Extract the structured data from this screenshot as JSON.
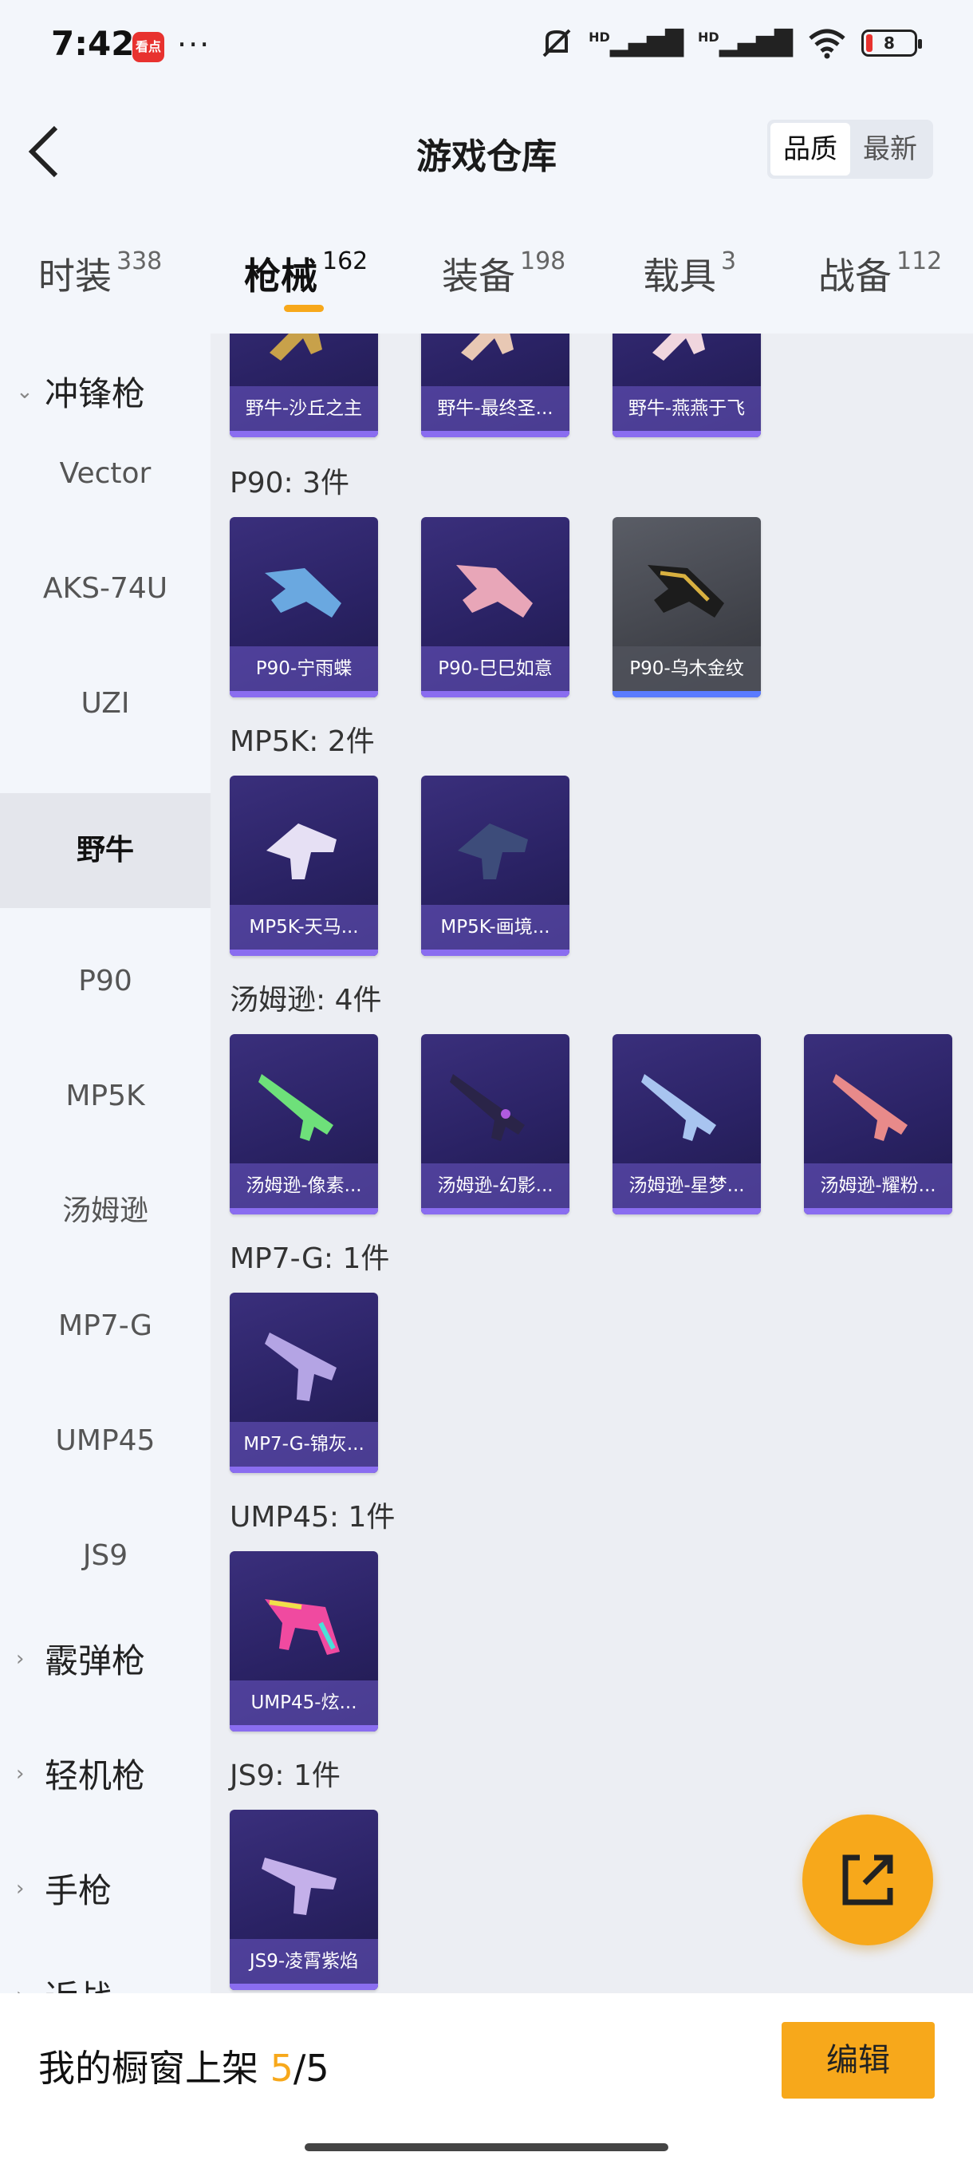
{
  "status": {
    "time": "7:42",
    "app_badge": "看点",
    "more": "···",
    "signal1": "HD",
    "signal2": "HD",
    "battery": "8"
  },
  "header": {
    "back_icon": "chevron-left-icon",
    "title": "游戏仓库",
    "sort": [
      "品质",
      "最新"
    ]
  },
  "tabs": [
    {
      "label": "时装",
      "count": "338"
    },
    {
      "label": "枪械",
      "count": "162"
    },
    {
      "label": "装备",
      "count": "198"
    },
    {
      "label": "载具",
      "count": "3"
    },
    {
      "label": "战备",
      "count": "112"
    }
  ],
  "sidebar": {
    "category": "冲锋枪",
    "subs": [
      "Vector",
      "AKS-74U",
      "UZI",
      "野牛",
      "P90",
      "MP5K",
      "汤姆逊",
      "MP7-G",
      "UMP45",
      "JS9"
    ],
    "others": [
      "霰弹枪",
      "轻机枪",
      "手枪",
      "近战"
    ]
  },
  "groups": [
    {
      "title": "",
      "items": [
        "野牛-沙丘之主",
        "野牛-最终圣...",
        "野牛-燕燕于飞"
      ]
    },
    {
      "title": "P90: 3件",
      "items": [
        "P90-宁雨蝶",
        "P90-巳巳如意",
        "P90-乌木金纹"
      ]
    },
    {
      "title": "MP5K: 2件",
      "items": [
        "MP5K-天马...",
        "MP5K-画境..."
      ]
    },
    {
      "title": "汤姆逊: 4件",
      "items": [
        "汤姆逊-像素...",
        "汤姆逊-幻影...",
        "汤姆逊-星梦...",
        "汤姆逊-耀粉..."
      ]
    },
    {
      "title": "MP7-G: 1件",
      "items": [
        "MP7-G-锦灰..."
      ]
    },
    {
      "title": "UMP45: 1件",
      "items": [
        "UMP45-炫..."
      ]
    },
    {
      "title": "JS9: 1件",
      "items": [
        "JS9-凌霄紫焰"
      ]
    }
  ],
  "bottom": {
    "label": "我的橱窗上架",
    "used": "5",
    "total": "/5",
    "edit": "编辑"
  },
  "fab": {
    "icon": "share-icon"
  }
}
